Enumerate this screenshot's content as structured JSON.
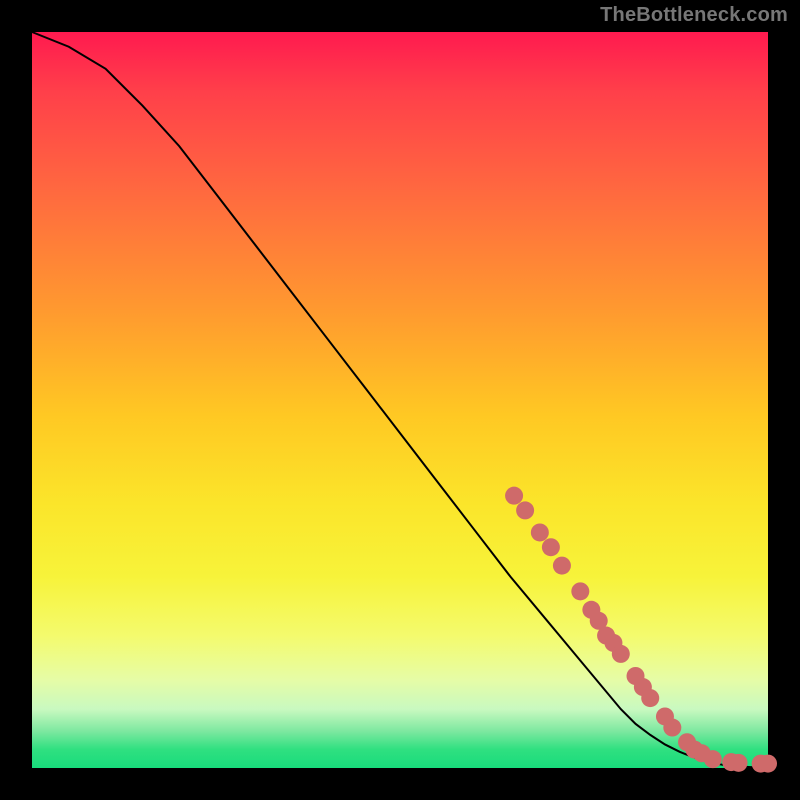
{
  "watermark": "TheBottleneck.com",
  "colors": {
    "background": "#000000",
    "dot_fill": "#cf6a6a",
    "curve_stroke": "#000000",
    "gradient_top": "#ff1a4f",
    "gradient_bottom": "#18dc7c"
  },
  "chart_data": {
    "type": "line",
    "title": "",
    "xlabel": "",
    "ylabel": "",
    "xlim": [
      0,
      100
    ],
    "ylim": [
      0,
      100
    ],
    "grid": false,
    "legend": false,
    "series": [
      {
        "name": "bottleneck-curve",
        "x": [
          0,
          5,
          10,
          15,
          20,
          25,
          30,
          35,
          40,
          45,
          50,
          55,
          60,
          65,
          70,
          75,
          80,
          82,
          84,
          86,
          88,
          90,
          92,
          94,
          96,
          98,
          100
        ],
        "y": [
          100,
          98,
          95,
          90,
          84.5,
          78,
          71.5,
          65,
          58.5,
          52,
          45.5,
          39,
          32.5,
          26,
          20,
          14,
          8,
          6,
          4.5,
          3.2,
          2.2,
          1.4,
          0.8,
          0.4,
          0.2,
          0.1,
          0.05
        ]
      }
    ],
    "points": [
      {
        "x": 65.5,
        "y": 37.0
      },
      {
        "x": 67.0,
        "y": 35.0
      },
      {
        "x": 69.0,
        "y": 32.0
      },
      {
        "x": 70.5,
        "y": 30.0
      },
      {
        "x": 72.0,
        "y": 27.5
      },
      {
        "x": 74.5,
        "y": 24.0
      },
      {
        "x": 76.0,
        "y": 21.5
      },
      {
        "x": 77.0,
        "y": 20.0
      },
      {
        "x": 78.0,
        "y": 18.0
      },
      {
        "x": 79.0,
        "y": 17.0
      },
      {
        "x": 80.0,
        "y": 15.5
      },
      {
        "x": 82.0,
        "y": 12.5
      },
      {
        "x": 83.0,
        "y": 11.0
      },
      {
        "x": 84.0,
        "y": 9.5
      },
      {
        "x": 86.0,
        "y": 7.0
      },
      {
        "x": 87.0,
        "y": 5.5
      },
      {
        "x": 89.0,
        "y": 3.5
      },
      {
        "x": 90.0,
        "y": 2.5
      },
      {
        "x": 91.0,
        "y": 2.0
      },
      {
        "x": 92.5,
        "y": 1.2
      },
      {
        "x": 95.0,
        "y": 0.8
      },
      {
        "x": 96.0,
        "y": 0.7
      },
      {
        "x": 99.0,
        "y": 0.6
      },
      {
        "x": 100.0,
        "y": 0.6
      }
    ]
  }
}
